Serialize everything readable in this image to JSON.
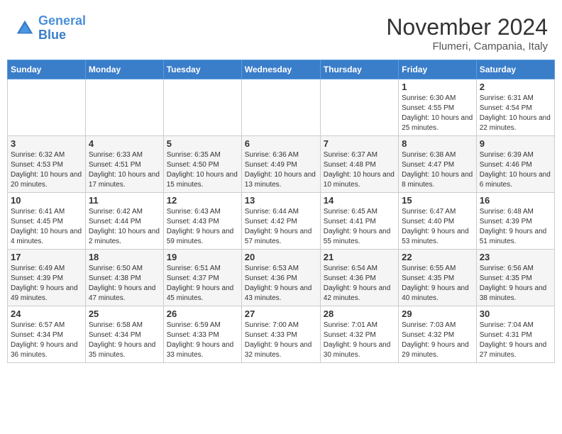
{
  "header": {
    "logo_line1": "General",
    "logo_line2": "Blue",
    "month_title": "November 2024",
    "location": "Flumeri, Campania, Italy"
  },
  "weekdays": [
    "Sunday",
    "Monday",
    "Tuesday",
    "Wednesday",
    "Thursday",
    "Friday",
    "Saturday"
  ],
  "weeks": [
    [
      {
        "day": "",
        "info": ""
      },
      {
        "day": "",
        "info": ""
      },
      {
        "day": "",
        "info": ""
      },
      {
        "day": "",
        "info": ""
      },
      {
        "day": "",
        "info": ""
      },
      {
        "day": "1",
        "info": "Sunrise: 6:30 AM\nSunset: 4:55 PM\nDaylight: 10 hours and 25 minutes."
      },
      {
        "day": "2",
        "info": "Sunrise: 6:31 AM\nSunset: 4:54 PM\nDaylight: 10 hours and 22 minutes."
      }
    ],
    [
      {
        "day": "3",
        "info": "Sunrise: 6:32 AM\nSunset: 4:53 PM\nDaylight: 10 hours and 20 minutes."
      },
      {
        "day": "4",
        "info": "Sunrise: 6:33 AM\nSunset: 4:51 PM\nDaylight: 10 hours and 17 minutes."
      },
      {
        "day": "5",
        "info": "Sunrise: 6:35 AM\nSunset: 4:50 PM\nDaylight: 10 hours and 15 minutes."
      },
      {
        "day": "6",
        "info": "Sunrise: 6:36 AM\nSunset: 4:49 PM\nDaylight: 10 hours and 13 minutes."
      },
      {
        "day": "7",
        "info": "Sunrise: 6:37 AM\nSunset: 4:48 PM\nDaylight: 10 hours and 10 minutes."
      },
      {
        "day": "8",
        "info": "Sunrise: 6:38 AM\nSunset: 4:47 PM\nDaylight: 10 hours and 8 minutes."
      },
      {
        "day": "9",
        "info": "Sunrise: 6:39 AM\nSunset: 4:46 PM\nDaylight: 10 hours and 6 minutes."
      }
    ],
    [
      {
        "day": "10",
        "info": "Sunrise: 6:41 AM\nSunset: 4:45 PM\nDaylight: 10 hours and 4 minutes."
      },
      {
        "day": "11",
        "info": "Sunrise: 6:42 AM\nSunset: 4:44 PM\nDaylight: 10 hours and 2 minutes."
      },
      {
        "day": "12",
        "info": "Sunrise: 6:43 AM\nSunset: 4:43 PM\nDaylight: 9 hours and 59 minutes."
      },
      {
        "day": "13",
        "info": "Sunrise: 6:44 AM\nSunset: 4:42 PM\nDaylight: 9 hours and 57 minutes."
      },
      {
        "day": "14",
        "info": "Sunrise: 6:45 AM\nSunset: 4:41 PM\nDaylight: 9 hours and 55 minutes."
      },
      {
        "day": "15",
        "info": "Sunrise: 6:47 AM\nSunset: 4:40 PM\nDaylight: 9 hours and 53 minutes."
      },
      {
        "day": "16",
        "info": "Sunrise: 6:48 AM\nSunset: 4:39 PM\nDaylight: 9 hours and 51 minutes."
      }
    ],
    [
      {
        "day": "17",
        "info": "Sunrise: 6:49 AM\nSunset: 4:39 PM\nDaylight: 9 hours and 49 minutes."
      },
      {
        "day": "18",
        "info": "Sunrise: 6:50 AM\nSunset: 4:38 PM\nDaylight: 9 hours and 47 minutes."
      },
      {
        "day": "19",
        "info": "Sunrise: 6:51 AM\nSunset: 4:37 PM\nDaylight: 9 hours and 45 minutes."
      },
      {
        "day": "20",
        "info": "Sunrise: 6:53 AM\nSunset: 4:36 PM\nDaylight: 9 hours and 43 minutes."
      },
      {
        "day": "21",
        "info": "Sunrise: 6:54 AM\nSunset: 4:36 PM\nDaylight: 9 hours and 42 minutes."
      },
      {
        "day": "22",
        "info": "Sunrise: 6:55 AM\nSunset: 4:35 PM\nDaylight: 9 hours and 40 minutes."
      },
      {
        "day": "23",
        "info": "Sunrise: 6:56 AM\nSunset: 4:35 PM\nDaylight: 9 hours and 38 minutes."
      }
    ],
    [
      {
        "day": "24",
        "info": "Sunrise: 6:57 AM\nSunset: 4:34 PM\nDaylight: 9 hours and 36 minutes."
      },
      {
        "day": "25",
        "info": "Sunrise: 6:58 AM\nSunset: 4:34 PM\nDaylight: 9 hours and 35 minutes."
      },
      {
        "day": "26",
        "info": "Sunrise: 6:59 AM\nSunset: 4:33 PM\nDaylight: 9 hours and 33 minutes."
      },
      {
        "day": "27",
        "info": "Sunrise: 7:00 AM\nSunset: 4:33 PM\nDaylight: 9 hours and 32 minutes."
      },
      {
        "day": "28",
        "info": "Sunrise: 7:01 AM\nSunset: 4:32 PM\nDaylight: 9 hours and 30 minutes."
      },
      {
        "day": "29",
        "info": "Sunrise: 7:03 AM\nSunset: 4:32 PM\nDaylight: 9 hours and 29 minutes."
      },
      {
        "day": "30",
        "info": "Sunrise: 7:04 AM\nSunset: 4:31 PM\nDaylight: 9 hours and 27 minutes."
      }
    ]
  ]
}
